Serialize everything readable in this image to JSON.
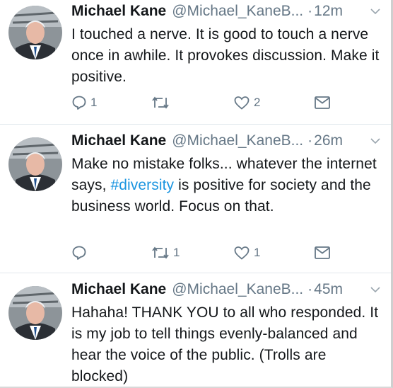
{
  "tweets": [
    {
      "name": "Michael Kane",
      "handle": "@Michael_KaneB...",
      "dot": "·",
      "time": "12m",
      "text": "I touched a nerve. It is good to touch a nerve once in awhile. It provokes discussion. Make it positive.",
      "replies": "1",
      "retweets": "",
      "likes": "2"
    },
    {
      "name": "Michael Kane",
      "handle": "@Michael_KaneB...",
      "dot": "·",
      "time": "26m",
      "text_before": "Make no mistake folks... whatever the internet says, ",
      "hashtag": "#diversity",
      "text_after": " is positive for society and the business world. Focus on that.",
      "replies": "",
      "retweets": "1",
      "likes": "1"
    },
    {
      "name": "Michael Kane",
      "handle": "@Michael_KaneB...",
      "dot": "·",
      "time": "45m",
      "text": "Hahaha! THANK YOU to all who responded. It is my job to tell things evenly-balanced and hear the voice of the public. (Trolls are blocked)"
    }
  ],
  "colors": {
    "link": "#1b95e0",
    "meta": "#657786",
    "text": "#14171a"
  },
  "icons": [
    "avatar",
    "chevron-down-icon",
    "reply-icon",
    "retweet-icon",
    "like-icon",
    "message-icon"
  ]
}
